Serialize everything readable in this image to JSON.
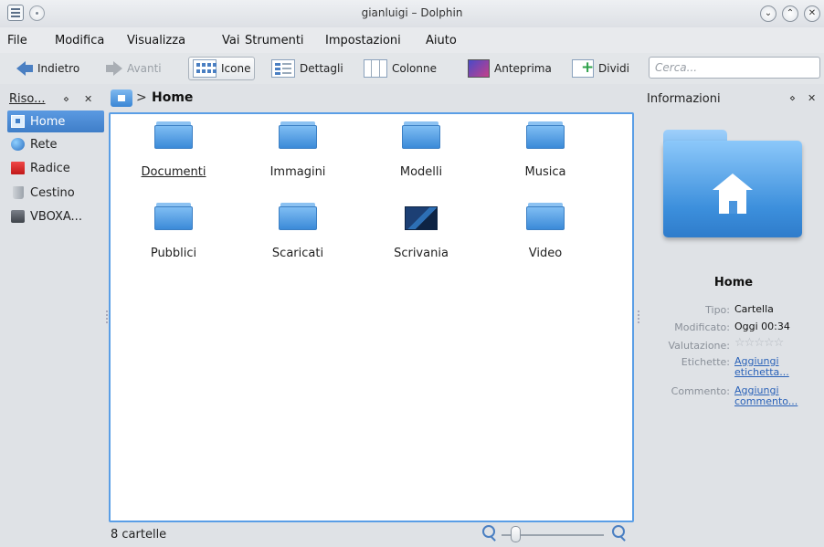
{
  "window": {
    "title": "gianluigi – Dolphin",
    "controls": {
      "minimize_glyph": "⌄",
      "maximize_glyph": "⌃",
      "close_glyph": "✕"
    }
  },
  "menu": {
    "items": [
      "File",
      "Modifica",
      "Visualizza",
      "Vai",
      "Strumenti",
      "Impostazioni",
      "Aiuto"
    ]
  },
  "toolbar": {
    "back": "Indietro",
    "forward": "Avanti",
    "icons": "Icone",
    "details": "Dettagli",
    "columns": "Colonne",
    "preview": "Anteprima",
    "split": "Dividi",
    "search_placeholder": "Cerca..."
  },
  "places": {
    "title": "Riso...",
    "items": [
      {
        "label": "Home",
        "icon": "home-icon",
        "selected": true
      },
      {
        "label": "Rete",
        "icon": "network-icon",
        "selected": false
      },
      {
        "label": "Radice",
        "icon": "root-folder-icon",
        "selected": false
      },
      {
        "label": "Cestino",
        "icon": "trash-icon",
        "selected": false
      },
      {
        "label": "VBOXA...",
        "icon": "drive-icon",
        "selected": false
      }
    ]
  },
  "breadcrumb": {
    "separator": ">",
    "current": "Home"
  },
  "files": [
    {
      "name": "Documenti",
      "icon": "folder-icon"
    },
    {
      "name": "Immagini",
      "icon": "folder-icon"
    },
    {
      "name": "Modelli",
      "icon": "folder-icon"
    },
    {
      "name": "Musica",
      "icon": "folder-icon"
    },
    {
      "name": "Pubblici",
      "icon": "folder-icon"
    },
    {
      "name": "Scaricati",
      "icon": "folder-icon"
    },
    {
      "name": "Scrivania",
      "icon": "desktop-icon"
    },
    {
      "name": "Video",
      "icon": "folder-icon"
    }
  ],
  "status": {
    "text": "8 cartelle",
    "zoom_level": 0.1
  },
  "info": {
    "title": "Informazioni",
    "name": "Home",
    "rows": [
      {
        "key": "Tipo:",
        "value": "Cartella"
      },
      {
        "key": "Modificato:",
        "value": "Oggi 00:34"
      },
      {
        "key": "Valutazione:",
        "value": ""
      },
      {
        "key": "Etichette:",
        "value": "Aggiungi etichetta..."
      },
      {
        "key": "Commento:",
        "value": "Aggiungi commento..."
      }
    ],
    "rating": 0
  },
  "colors": {
    "accent": "#3f7ec8",
    "selection": "#5a9ee6",
    "link": "#2a62b8"
  }
}
